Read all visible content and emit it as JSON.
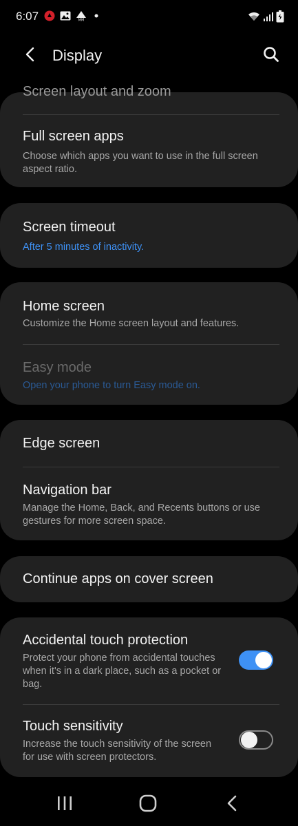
{
  "status_bar": {
    "time": "6:07",
    "left_icons": [
      "notification-app-icon",
      "image-icon",
      "mm-app-icon",
      "dot-icon"
    ],
    "right_icons": [
      "wifi-icon",
      "signal-icon",
      "battery-icon"
    ]
  },
  "header": {
    "title": "Display",
    "back_icon": "back-arrow-icon",
    "search_icon": "search-icon"
  },
  "settings": {
    "screen_layout": {
      "title": "Screen layout and zoom"
    },
    "full_screen_apps": {
      "title": "Full screen apps",
      "subtitle": "Choose which apps you want to use in the full screen aspect ratio."
    },
    "screen_timeout": {
      "title": "Screen timeout",
      "subtitle": "After 5 minutes of inactivity."
    },
    "home_screen": {
      "title": "Home screen",
      "subtitle": "Customize the Home screen layout and features."
    },
    "easy_mode": {
      "title": "Easy mode",
      "subtitle": "Open your phone to turn Easy mode on."
    },
    "edge_screen": {
      "title": "Edge screen"
    },
    "navigation_bar": {
      "title": "Navigation bar",
      "subtitle": "Manage the Home, Back, and Recents buttons or use gestures for more screen space."
    },
    "continue_apps": {
      "title": "Continue apps on cover screen"
    },
    "accidental_touch": {
      "title": "Accidental touch protection",
      "subtitle": "Protect your phone from accidental touches when it's in a dark place, such as a pocket or bag.",
      "enabled": true
    },
    "touch_sensitivity": {
      "title": "Touch sensitivity",
      "subtitle": "Increase the touch sensitivity of the screen for use with screen protectors.",
      "enabled": false
    }
  },
  "nav_bar": {
    "recents_icon": "recents-icon",
    "home_icon": "home-icon",
    "back_icon": "back-icon"
  },
  "colors": {
    "background": "#000000",
    "card": "#212121",
    "accent": "#3e91f5",
    "text_primary": "#f2f2f2",
    "text_secondary": "#a8a8a8"
  }
}
